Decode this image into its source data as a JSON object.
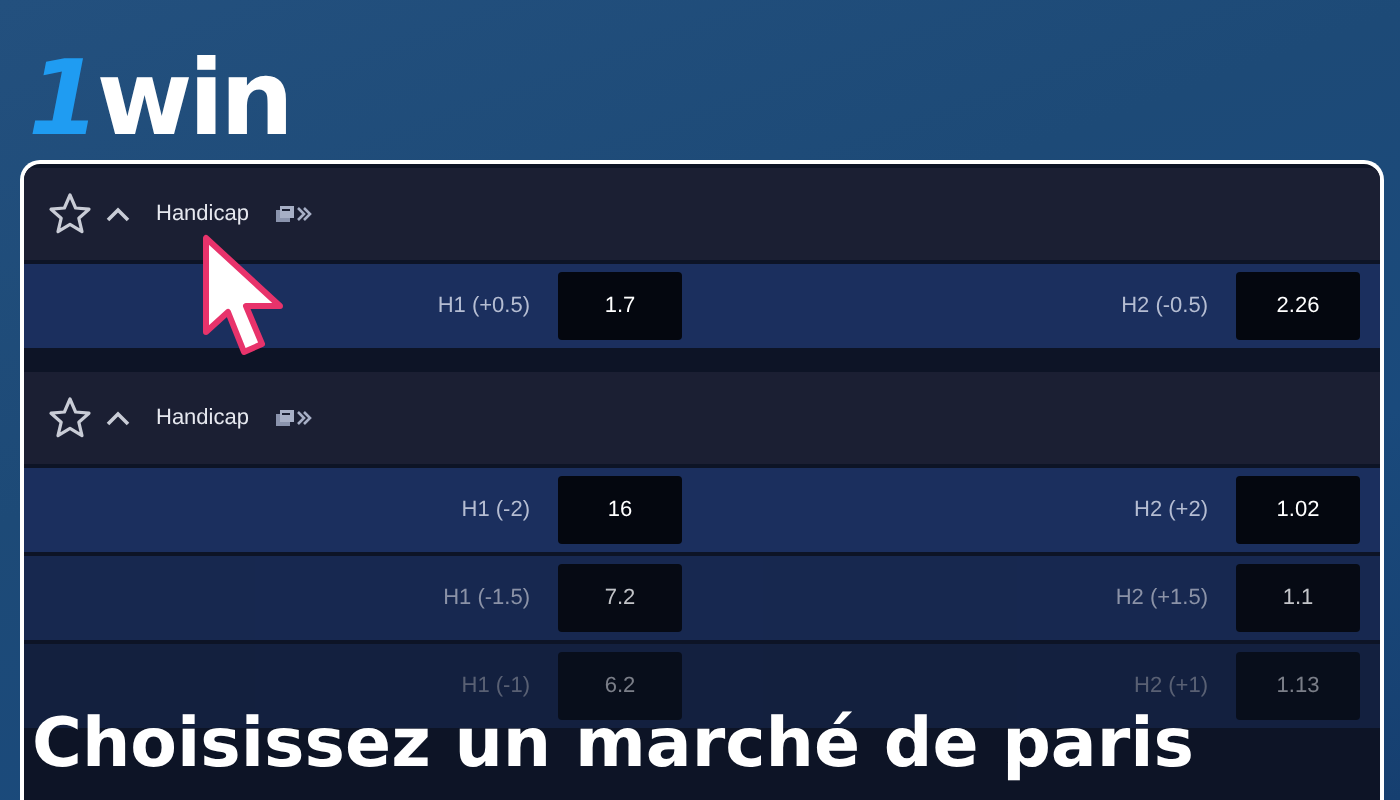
{
  "logo": {
    "mark": "1",
    "text": "win"
  },
  "markets": [
    {
      "title": "Handicap",
      "favorite": false,
      "expanded": true,
      "rows": [
        {
          "left_label": "H1 (+0.5)",
          "left_odds": "1.7",
          "right_label": "H2 (-0.5)",
          "right_odds": "2.26"
        }
      ]
    },
    {
      "title": "Handicap",
      "favorite": false,
      "expanded": true,
      "rows": [
        {
          "left_label": "H1 (-2)",
          "left_odds": "16",
          "right_label": "H2 (+2)",
          "right_odds": "1.02"
        },
        {
          "left_label": "H1 (-1.5)",
          "left_odds": "7.2",
          "right_label": "H2 (+1.5)",
          "right_odds": "1.1"
        },
        {
          "left_label": "H1 (-1)",
          "left_odds": "6.2",
          "right_label": "H2 (+1)",
          "right_odds": "1.13"
        }
      ]
    }
  ],
  "caption": "Choisissez un marché de paris"
}
